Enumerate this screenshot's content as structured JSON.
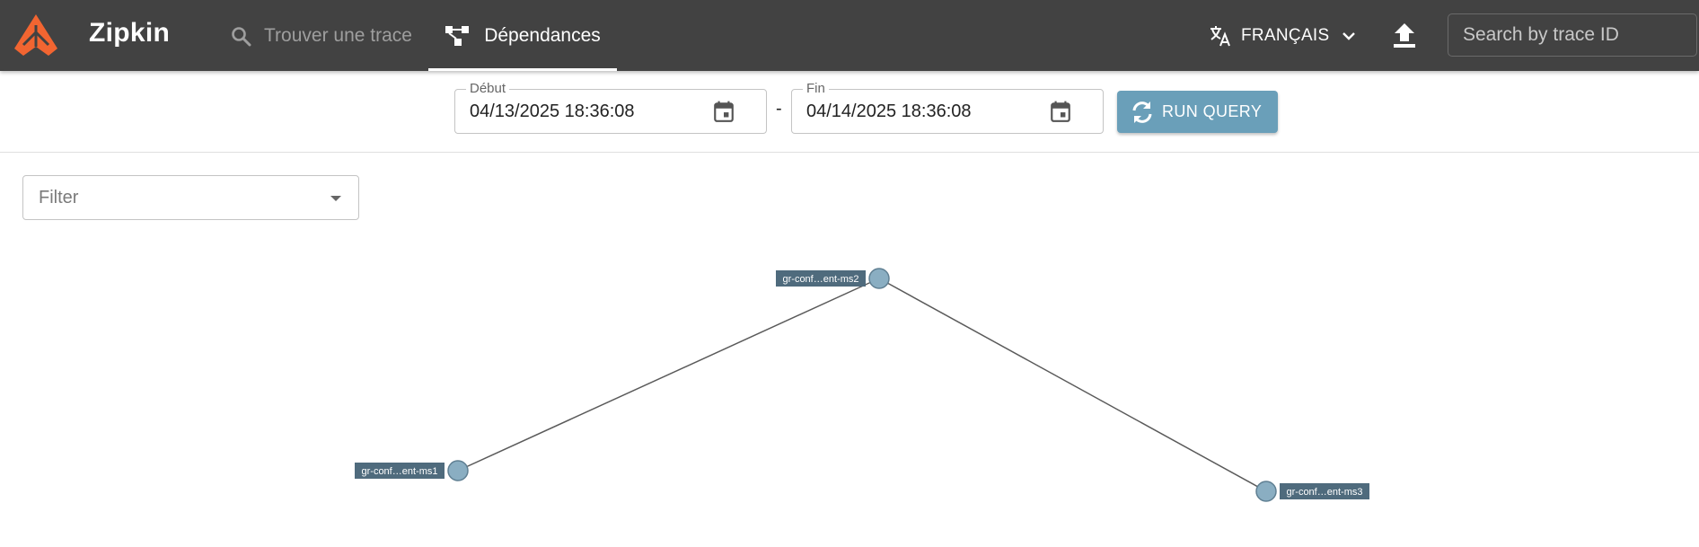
{
  "header": {
    "app_name": "Zipkin",
    "logo_icon": "zipkin-logo-icon",
    "nav": [
      {
        "label": "Trouver une trace",
        "icon": "search-icon",
        "active": false
      },
      {
        "label": "Dépendances",
        "icon": "dependencies-icon",
        "active": true
      }
    ],
    "language": {
      "label": "FRANÇAIS",
      "icon": "translate-icon"
    },
    "upload_icon": "upload-icon",
    "trace_search_placeholder": "Search by trace ID"
  },
  "query": {
    "start": {
      "label": "Début",
      "value": "04/13/2025 18:36:08"
    },
    "separator": "-",
    "end": {
      "label": "Fin",
      "value": "04/14/2025 18:36:08"
    },
    "run_label": "RUN QUERY"
  },
  "filter": {
    "placeholder": "Filter"
  },
  "graph": {
    "nodes": [
      {
        "id": "ms2",
        "label": "gr-conf…ent-ms2"
      },
      {
        "id": "ms1",
        "label": "gr-conf…ent-ms1"
      },
      {
        "id": "ms3",
        "label": "gr-conf…ent-ms3"
      }
    ],
    "edges": [
      {
        "from": "ms2",
        "to": "ms1"
      },
      {
        "from": "ms2",
        "to": "ms3"
      }
    ]
  },
  "colors": {
    "header_bg": "#424242",
    "logo": "#f26531",
    "run_button": "#6a9fb9",
    "node_fill": "#8aaec2",
    "node_label_bg": "#4f6b7d"
  }
}
